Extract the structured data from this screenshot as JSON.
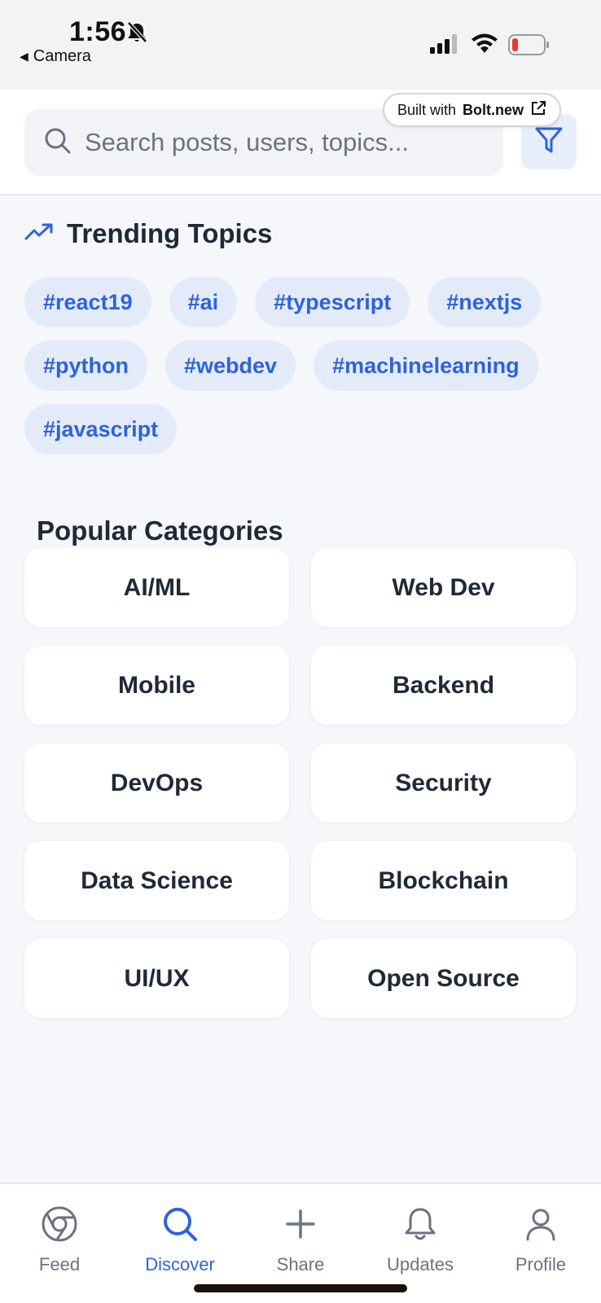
{
  "status_bar": {
    "time": "1:56",
    "back_label": "Camera",
    "icons": [
      "bell-off-icon",
      "signal-icon",
      "wifi-icon",
      "battery-icon"
    ]
  },
  "header": {
    "search_placeholder": "Search posts, users, topics...",
    "badge_prefix": "Built with",
    "badge_brand": "Bolt.new"
  },
  "trending": {
    "title": "Trending Topics",
    "tags": [
      "#react19",
      "#ai",
      "#typescript",
      "#nextjs",
      "#python",
      "#webdev",
      "#machinelearning",
      "#javascript"
    ]
  },
  "categories": {
    "title": "Popular Categories",
    "items": [
      "AI/ML",
      "Web Dev",
      "Mobile",
      "Backend",
      "DevOps",
      "Security",
      "Data Science",
      "Blockchain",
      "UI/UX",
      "Open Source"
    ]
  },
  "tabbar": {
    "tabs": [
      {
        "label": "Feed",
        "icon": "feed-icon"
      },
      {
        "label": "Discover",
        "icon": "search-icon",
        "active": true
      },
      {
        "label": "Share",
        "icon": "plus-icon"
      },
      {
        "label": "Updates",
        "icon": "bell-icon"
      },
      {
        "label": "Profile",
        "icon": "user-icon"
      }
    ]
  },
  "colors": {
    "accent": "#2f63d8",
    "tag_bg": "#e3ebfb",
    "page_bg": "#f5f7fa",
    "text": "#1f2937",
    "muted": "#6b7280"
  }
}
